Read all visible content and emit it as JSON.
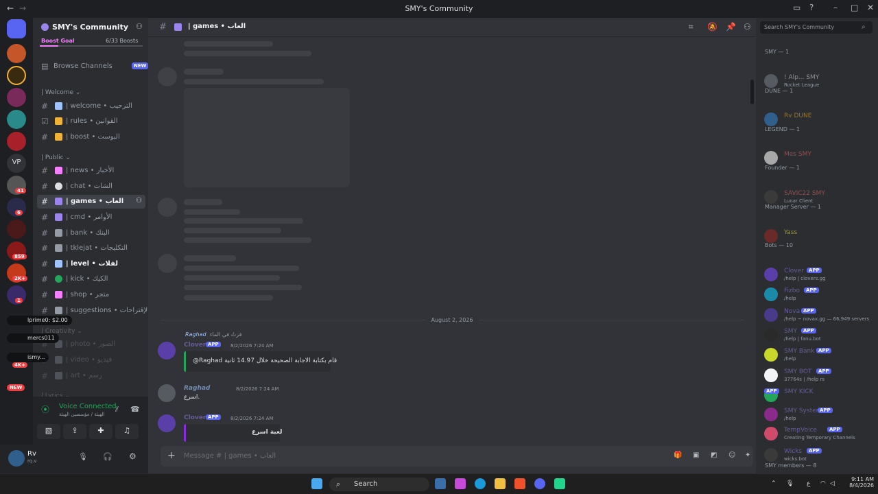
{
  "window": {
    "title": "SMY's Community",
    "back": "←",
    "forward": "→"
  },
  "servers": {
    "badges": [
      "41",
      "6",
      "859",
      "2K+",
      "1",
      "4K+"
    ],
    "vp_label": "VP",
    "new_label": "NEW"
  },
  "guild": {
    "name": "SMY's Community",
    "boost_goal": "Boost Goal",
    "boost_count": "6/33 Boosts",
    "browse_channels": "Browse Channels",
    "browse_badge": "NEW"
  },
  "categories": {
    "welcome": "| Welcome",
    "public": "| Public",
    "creativity": "| Creativity",
    "lyrics": "| Lyrics"
  },
  "channels": [
    {
      "label": "| welcome • الترحيب",
      "color": "#a0c4ff"
    },
    {
      "label": "| rules • القوانين",
      "color": "#f0b232"
    },
    {
      "label": "| boost • البوست",
      "color": "#f0b232"
    },
    {
      "label": "| news • الأخبار",
      "color": "#f47fff"
    },
    {
      "label": "| chat • الشات",
      "color": "#dbdee1"
    },
    {
      "label": "| games • العاب",
      "color": "#9b84ec"
    },
    {
      "label": "| cmd • الأوامر",
      "color": "#9b84ec"
    },
    {
      "label": "| bank • البنك",
      "color": "#949ba4"
    },
    {
      "label": "| tklejat • التكليجات",
      "color": "#949ba4"
    },
    {
      "label": "| level • لفلات",
      "color": "#a0c4ff"
    },
    {
      "label": "| kick • الكيك",
      "color": "#23a55a"
    },
    {
      "label": "| shop • متجر",
      "color": "#f47fff"
    },
    {
      "label": "| suggestions • الإقتراحات",
      "color": "#949ba4"
    },
    {
      "label": "| photo • الصور",
      "color": "#949ba4"
    },
    {
      "label": "| video • فيديو",
      "color": "#949ba4"
    },
    {
      "label": "| art • رسم",
      "color": "#949ba4"
    }
  ],
  "tooltips": [
    "lprime0: $2.00",
    "mercs011",
    "ismy..."
  ],
  "voice": {
    "status": "Voice Connected",
    "channel": "الهيئة / مؤسسين الهيئة"
  },
  "user": {
    "name": "Rv",
    "tag": "rq.v"
  },
  "header": {
    "channel_name": "| games • العاب"
  },
  "messages": {
    "date": "August 2, 2026",
    "reply_preview": "فزتُ في الماء",
    "reply_user": "Raghad",
    "m1_name": "Clover",
    "m1_time": "8/2/2026 7:24 AM",
    "m1_text": "@Raghad قام بكتابة الاجابة الصحيحة خلال 14.97 ثانية",
    "m2_name": "Raghad",
    "m2_time": "8/2/2026 7:24 AM",
    "m2_text": "اسرع.",
    "m3_name": "Clover",
    "m3_time": "8/2/2026 7:24 AM",
    "m3_text": "لعبة اسرع",
    "app": "APP"
  },
  "input": {
    "placeholder": "Message # | games • العاب"
  },
  "members": {
    "search_placeholder": "Search SMY's Community",
    "roles": [
      "SMY — 1",
      "DUNE — 1",
      "LEGEND — 1",
      "Founder — 1",
      "Manager Server — 1",
      "Bots — 10"
    ],
    "footer": "SMY members — 8",
    "list": [
      {
        "name": "! Alp... SMY",
        "status": "Rocket League",
        "color": "#dbdee1",
        "avatar": "#565a61"
      },
      {
        "name": "Rv DUNE",
        "status": "",
        "color": "#f0b232",
        "avatar": "#2f5f8a"
      },
      {
        "name": "Mes SMY",
        "status": "",
        "color": "#e06c6c",
        "avatar": "#a8a8a8"
      },
      {
        "name": "SAVIC22 SMY",
        "status": "Lunar Client",
        "color": "#e06c6c",
        "avatar": "#3a3a3a"
      },
      {
        "name": "Yass",
        "status": "",
        "color": "#f0e442",
        "avatar": "#6a2a2a"
      },
      {
        "name": "Clover",
        "status": "/help | clovers.gg",
        "color": "#9b84ec",
        "avatar": "#5b3fa8"
      },
      {
        "name": "Fizbo",
        "status": "/help",
        "color": "#9b84ec",
        "avatar": "#1a8aa8"
      },
      {
        "name": "Nova",
        "status": "/help ~ novax.gg — 66,949 servers",
        "color": "#9b84ec",
        "avatar": "#4a3a8a"
      },
      {
        "name": "SMY",
        "status": "/help | fanu.bot",
        "color": "#9b84ec",
        "avatar": "#2a2a2a"
      },
      {
        "name": "SMY Bank",
        "status": "/help",
        "color": "#9b84ec",
        "avatar": "#c8d82a"
      },
      {
        "name": "SMY BOT",
        "status": "37764s | /help rs",
        "color": "#9b84ec",
        "avatar": "#f2f3f5"
      },
      {
        "name": "SMY KICK",
        "status": "",
        "color": "#9b84ec",
        "avatar": "#23a55a"
      },
      {
        "name": "SMY System",
        "status": "/help",
        "color": "#9b84ec",
        "avatar": "#8a2a8a"
      },
      {
        "name": "TempVoice",
        "status": "Creating Temporary Channels",
        "color": "#9b84ec",
        "avatar": "#d04a6a"
      },
      {
        "name": "Wicks",
        "status": "wicks.bot",
        "color": "#9b84ec",
        "avatar": "#3a3a3a"
      }
    ]
  },
  "taskbar": {
    "search": "Search",
    "time": "9:11 AM",
    "date": "8/4/2026",
    "lang": "ع"
  },
  "colors": {
    "accent": "#5865f2",
    "online": "#23a55a",
    "danger": "#f23f43"
  }
}
